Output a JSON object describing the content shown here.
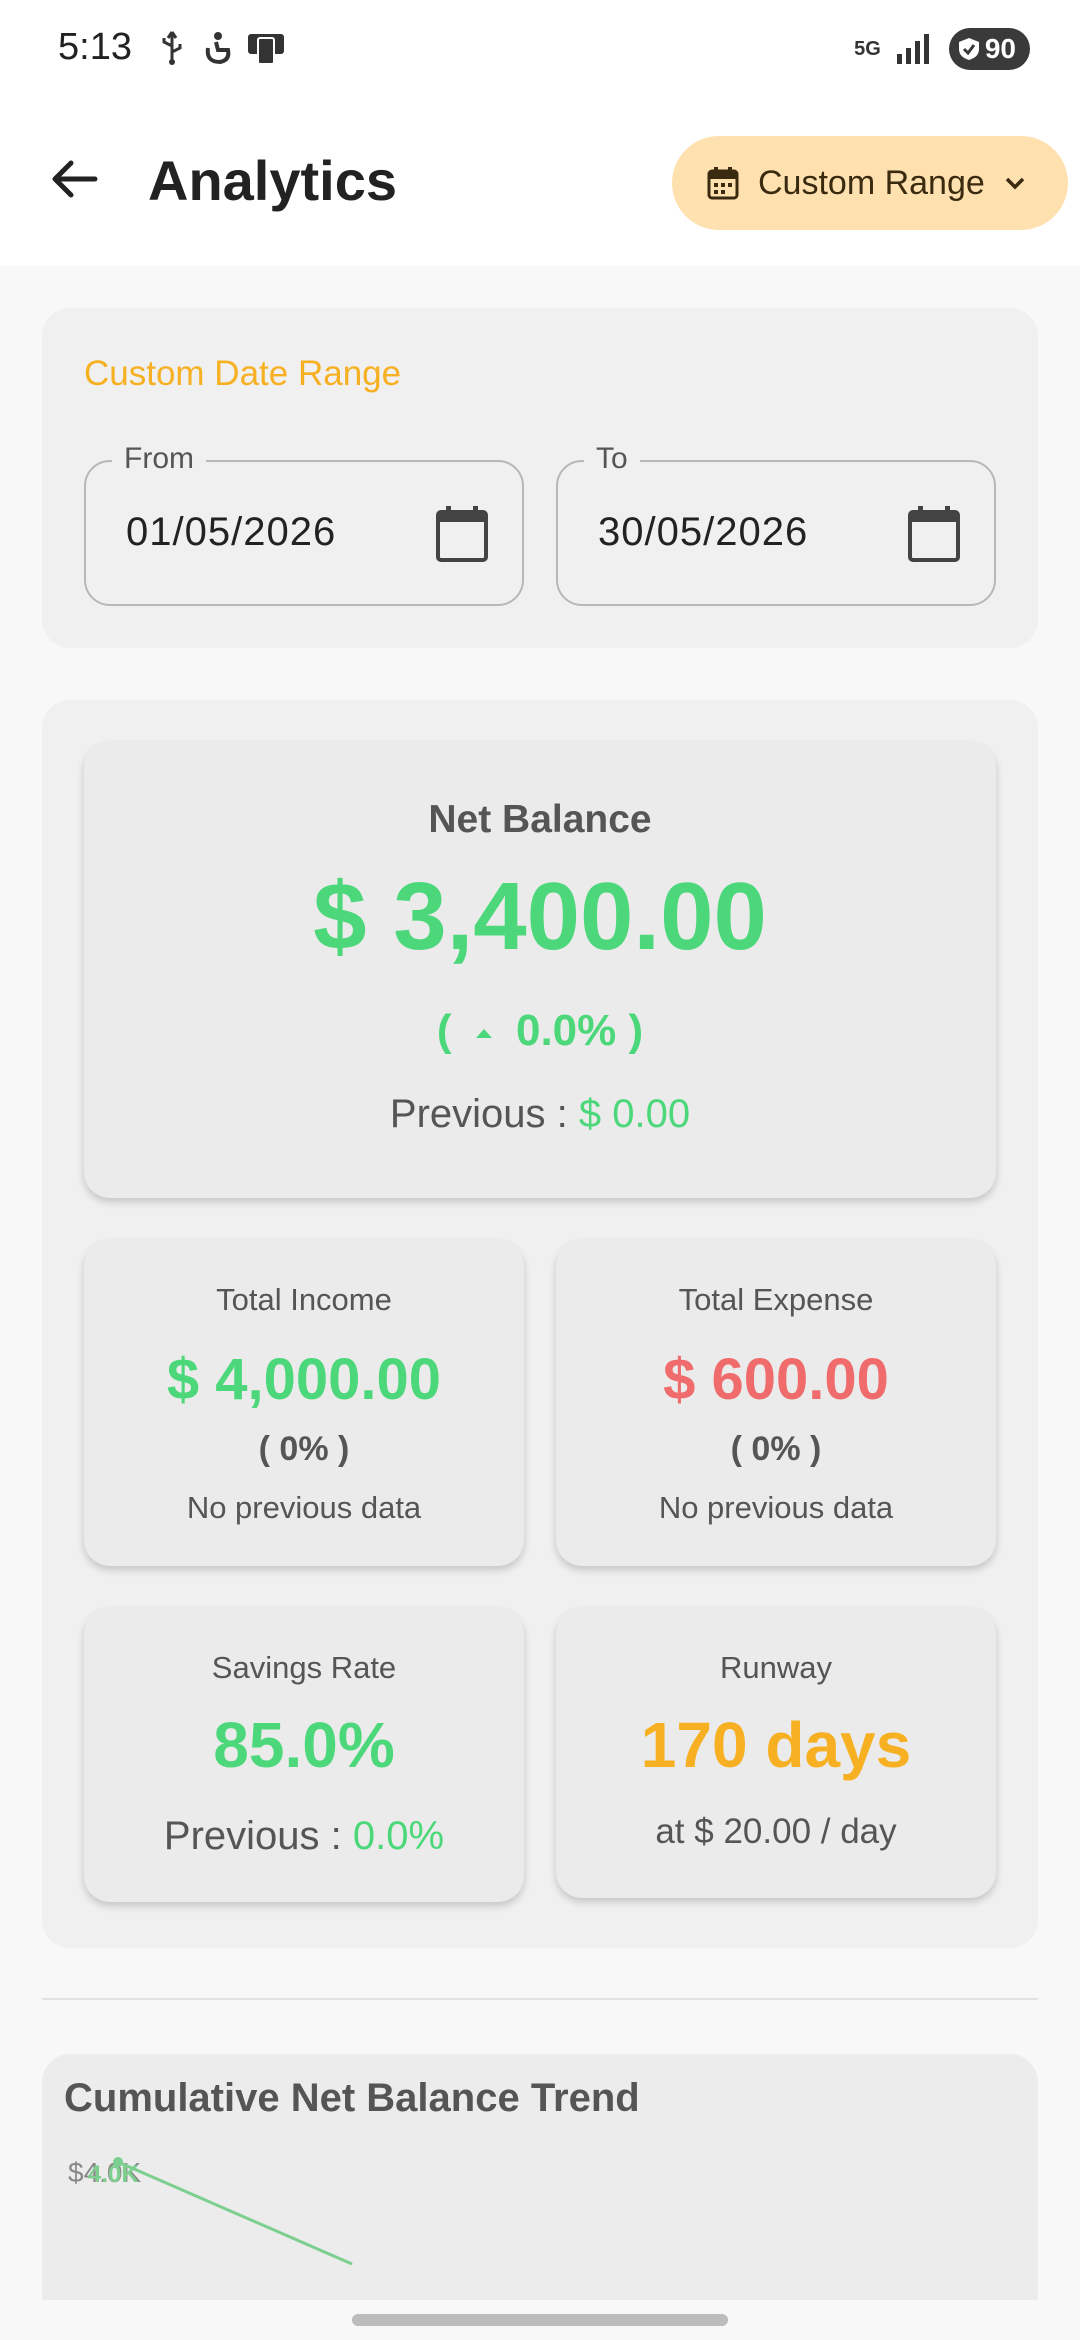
{
  "status_bar": {
    "time": "5:13",
    "network": "5G",
    "battery": "90"
  },
  "app_bar": {
    "title": "Analytics",
    "range_button_label": "Custom Range"
  },
  "date_range": {
    "heading": "Custom Date Range",
    "from_label": "From",
    "from_value": "01/05/2026",
    "to_label": "To",
    "to_value": "30/05/2026"
  },
  "net_balance": {
    "label": "Net Balance",
    "value": "$ 3,400.00",
    "change_open": "(",
    "change_value": "0.0%",
    "change_close": ")",
    "previous_label": "Previous :",
    "previous_value": "$ 0.00"
  },
  "income": {
    "label": "Total Income",
    "value": "$ 4,000.00",
    "change": "( 0% )",
    "note": "No previous data"
  },
  "expense": {
    "label": "Total Expense",
    "value": "$ 600.00",
    "change": "( 0% )",
    "note": "No previous data"
  },
  "savings": {
    "label": "Savings Rate",
    "value": "85.0%",
    "previous_label": "Previous :",
    "previous_value": "0.0%"
  },
  "runway": {
    "label": "Runway",
    "value": "170 days",
    "note": "at $ 20.00 / day"
  },
  "trend": {
    "title": "Cumulative Net Balance Trend",
    "y_tick_top": "$4.0K",
    "point_label": "4.0K"
  },
  "colors": {
    "positive": "#4cd87a",
    "negative": "#f06b6b",
    "warning": "#f6b021",
    "accent_bg": "#ffe1b0"
  }
}
